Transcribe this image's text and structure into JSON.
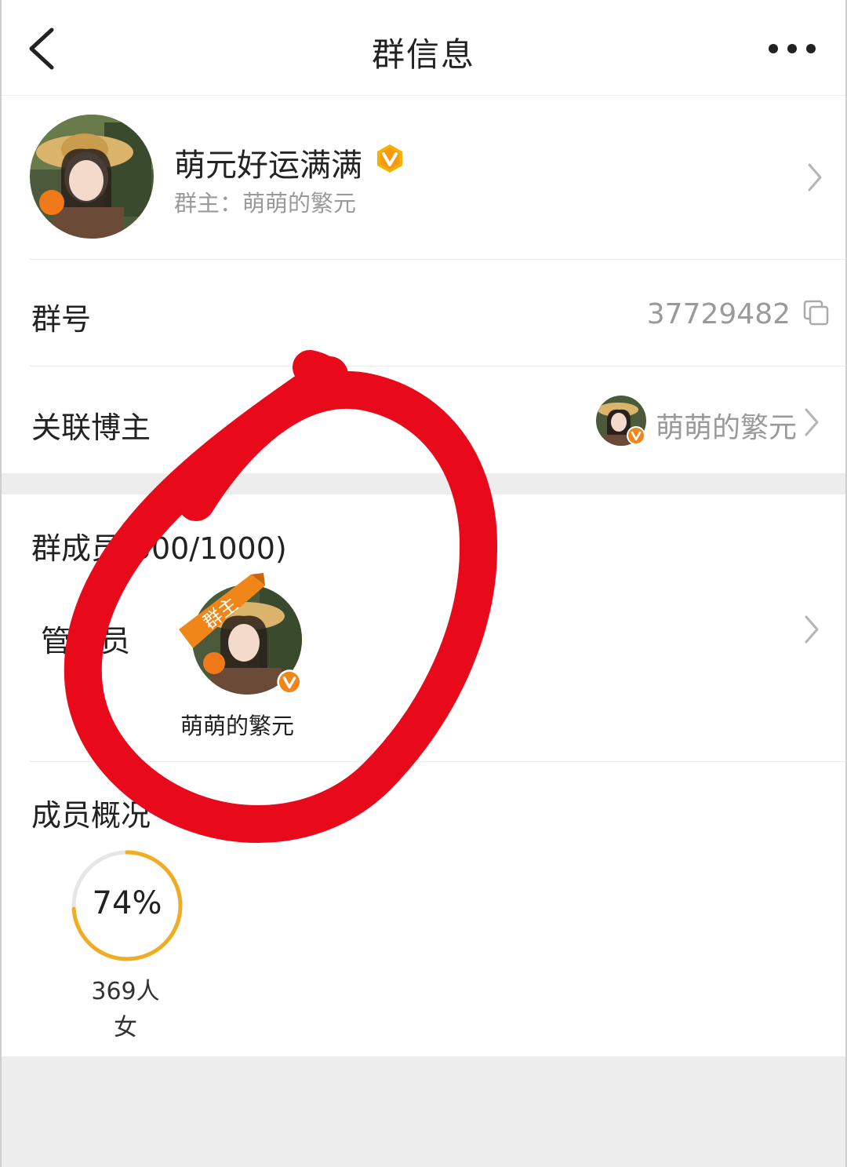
{
  "header": {
    "title": "群信息",
    "back_icon": "chevron-left-icon",
    "more_icon": "more-dots-icon"
  },
  "group": {
    "name": "萌元好运满满",
    "owner_line": "群主：萌萌的繁元",
    "verified_icon": "verified-v-badge-icon"
  },
  "group_number": {
    "label": "群号",
    "value": "37729482",
    "copy_icon": "copy-icon"
  },
  "linked_blogger": {
    "label": "关联博主",
    "name": "萌萌的繁元"
  },
  "members": {
    "title": "群成员(500/1000)",
    "admin_label": "管理员",
    "owner_ribbon": "群主",
    "admin_name": "萌萌的繁元"
  },
  "overview": {
    "title": "成员概况",
    "female_percent_text": "74%",
    "female_fraction": 0.74,
    "count": "369人",
    "gender": "女"
  },
  "colors": {
    "accent_orange": "#f08519",
    "ring_yellow": "#f0ad22",
    "annotation_red": "#e8091b"
  }
}
